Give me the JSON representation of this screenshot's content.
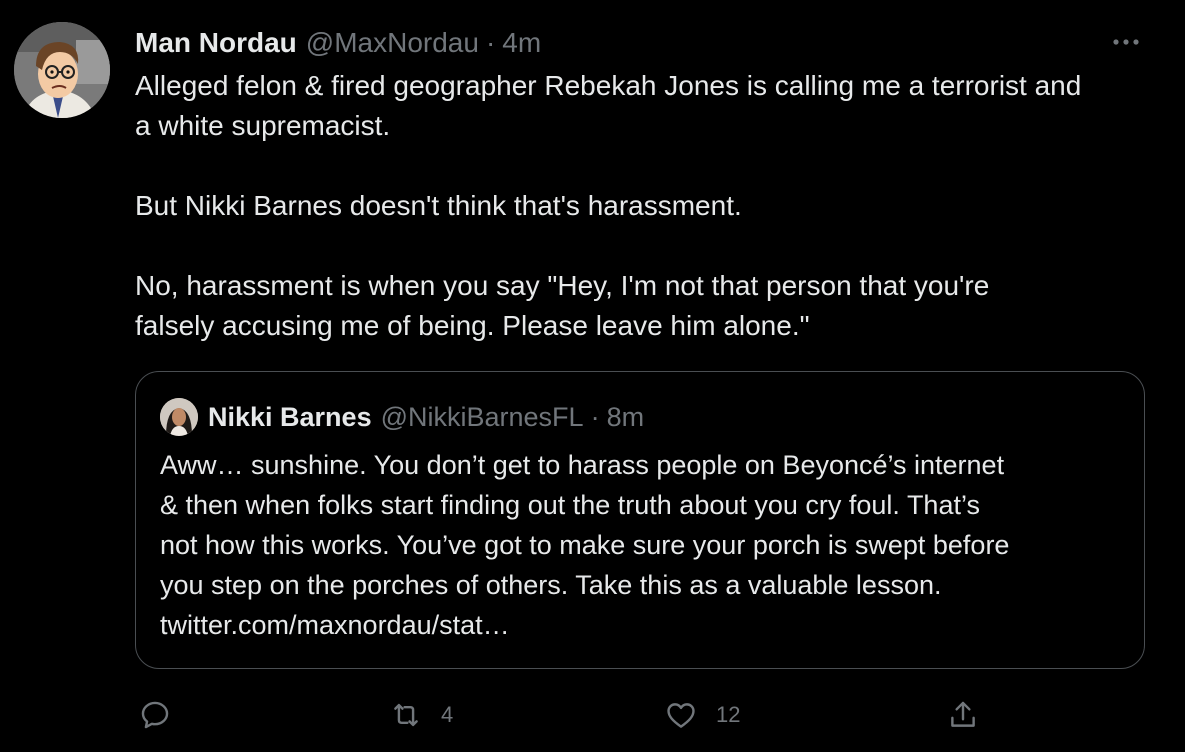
{
  "tweet": {
    "author": {
      "display_name": "Man Nordau",
      "handle": "@MaxNordau",
      "avatar_icon": "cartoon-avatar-icon"
    },
    "separator": "·",
    "time": "4m",
    "more_icon": "more-options-icon",
    "body": {
      "p1_line1": "Alleged felon & fired geographer Rebekah Jones is calling me a terrorist and",
      "p1_line2": "a white supremacist.",
      "p2": "But Nikki Barnes doesn't think that's harassment.",
      "p3_line1": "No, harassment is when you say \"Hey, I'm not that person that you're",
      "p3_line2": "falsely accusing me of being. Please leave him alone.\""
    }
  },
  "quoted_tweet": {
    "author": {
      "display_name": "Nikki Barnes",
      "handle": "@NikkiBarnesFL",
      "avatar_icon": "profile-photo-avatar"
    },
    "separator": "·",
    "time": "8m",
    "lines": [
      "Aww… sunshine. You don’t get to harass people on Beyoncé’s internet",
      "& then when folks start finding out the truth about you cry foul. That’s",
      "not how this works. You’ve got to make sure your porch is swept before",
      "you step on the porches of others. Take this as a valuable lesson.",
      "twitter.com/maxnordau/stat…"
    ]
  },
  "actions": {
    "reply": {
      "icon": "reply-icon",
      "count": ""
    },
    "retweet": {
      "icon": "retweet-icon",
      "count": "4"
    },
    "like": {
      "icon": "heart-icon",
      "count": "12"
    },
    "share": {
      "icon": "share-icon"
    }
  },
  "colors": {
    "background": "#000000",
    "text_primary": "#e7e9ea",
    "text_secondary": "#71767b",
    "border": "#4a4e52"
  }
}
